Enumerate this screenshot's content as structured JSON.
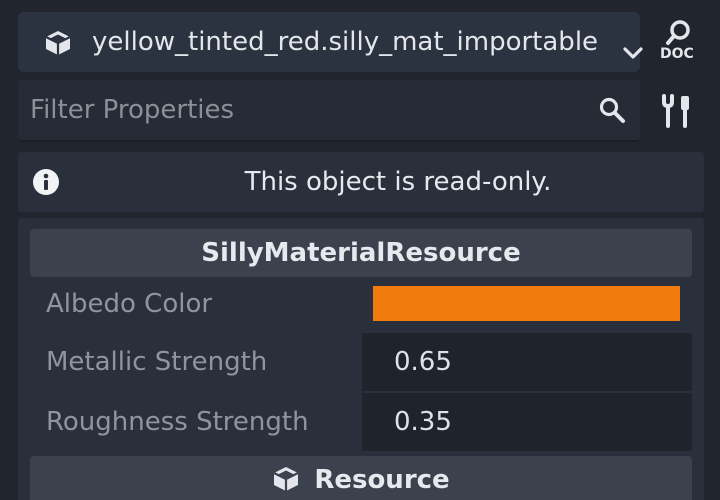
{
  "resource_picker": {
    "name": "yellow_tinted_red.silly_mat_importable",
    "icon": "cube-icon"
  },
  "doc_button": {
    "label": "DOC",
    "icon": "doc-search-icon"
  },
  "filter": {
    "placeholder": "Filter Properties",
    "value": ""
  },
  "info": {
    "message": "This object is read-only."
  },
  "sections": {
    "main": {
      "title": "SillyMaterialResource",
      "properties": [
        {
          "label": "Albedo Color",
          "type": "color",
          "color": "#f27b0d"
        },
        {
          "label": "Metallic Strength",
          "value": "0.65"
        },
        {
          "label": "Roughness Strength",
          "value": "0.35"
        }
      ]
    },
    "resource": {
      "title": "Resource",
      "icon": "cube-icon"
    }
  },
  "colors": {
    "background": "#21262e",
    "panel": "#2a303b",
    "header": "#3b414d",
    "albedo": "#f27b0d"
  }
}
